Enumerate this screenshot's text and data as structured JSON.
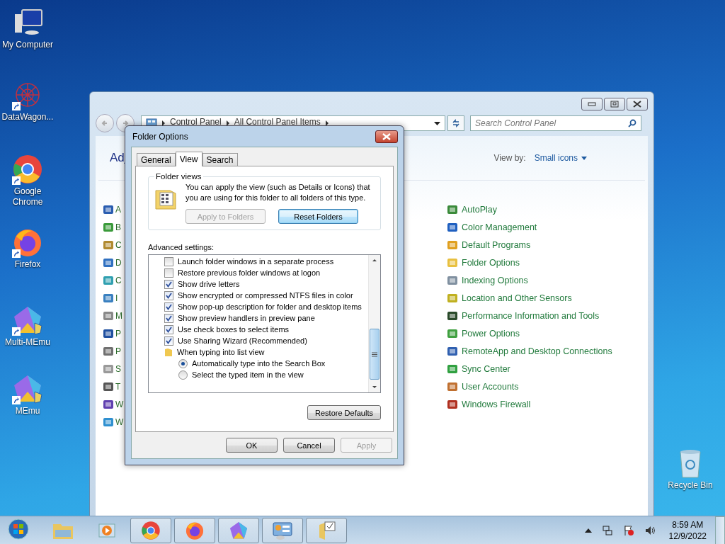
{
  "desktop_icons": [
    {
      "label": "My Computer",
      "kind": "computer",
      "shortcut": false
    },
    {
      "label": "DataWagon...",
      "kind": "network",
      "shortcut": true
    },
    {
      "label": "Google Chrome",
      "kind": "chrome",
      "shortcut": true
    },
    {
      "label": "Firefox",
      "kind": "firefox",
      "shortcut": true
    },
    {
      "label": "Multi-MEmu",
      "kind": "memu",
      "shortcut": true
    },
    {
      "label": "MEmu",
      "kind": "memu",
      "shortcut": true
    }
  ],
  "recycle_bin": {
    "label": "Recycle Bin"
  },
  "control_panel": {
    "breadcrumb": [
      "Control Panel",
      "All Control Panel Items"
    ],
    "search_placeholder": "Search Control Panel",
    "heading": "Adj",
    "view_by_label": "View by:",
    "view_by_value": "Small icons",
    "left_items": [
      "A",
      "B",
      "C",
      "D",
      "C",
      "I",
      "M",
      "P",
      "P",
      "S",
      "T",
      "W",
      "W"
    ],
    "right_items": [
      "AutoPlay",
      "Color Management",
      "Default Programs",
      "Folder Options",
      "Indexing Options",
      "Location and Other Sensors",
      "Performance Information and Tools",
      "Power Options",
      "RemoteApp and Desktop Connections",
      "Sync Center",
      "User Accounts",
      "Windows Firewall"
    ]
  },
  "dialog": {
    "title": "Folder Options",
    "tabs": [
      {
        "label": "General",
        "selected": false
      },
      {
        "label": "View",
        "selected": true
      },
      {
        "label": "Search",
        "selected": false
      }
    ],
    "folder_views": {
      "legend": "Folder views",
      "text": "You can apply the view (such as Details or Icons) that you are using for this folder to all folders of this type.",
      "buttons": [
        {
          "label": "Apply to Folders",
          "disabled": true,
          "focused": false
        },
        {
          "label": "Reset Folders",
          "disabled": false,
          "focused": true
        }
      ]
    },
    "advanced_label": "Advanced settings:",
    "settings": [
      {
        "kind": "checkbox",
        "label": "Launch folder windows in a separate process",
        "checked": false
      },
      {
        "kind": "checkbox",
        "label": "Restore previous folder windows at logon",
        "checked": false
      },
      {
        "kind": "checkbox",
        "label": "Show drive letters",
        "checked": true
      },
      {
        "kind": "checkbox",
        "label": "Show encrypted or compressed NTFS files in color",
        "checked": true
      },
      {
        "kind": "checkbox",
        "label": "Show pop-up description for folder and desktop items",
        "checked": true
      },
      {
        "kind": "checkbox",
        "label": "Show preview handlers in preview pane",
        "checked": true
      },
      {
        "kind": "checkbox",
        "label": "Use check boxes to select items",
        "checked": true
      },
      {
        "kind": "checkbox",
        "label": "Use Sharing Wizard (Recommended)",
        "checked": true
      },
      {
        "kind": "folder",
        "label": "When typing into list view",
        "children": [
          {
            "kind": "radio",
            "label": "Automatically type into the Search Box",
            "selected": true
          },
          {
            "kind": "radio",
            "label": "Select the typed item in the view",
            "selected": false
          }
        ]
      }
    ],
    "restore_defaults": "Restore Defaults",
    "buttons": [
      {
        "label": "OK",
        "disabled": false
      },
      {
        "label": "Cancel",
        "disabled": false
      },
      {
        "label": "Apply",
        "disabled": true
      }
    ]
  },
  "taskbar": {
    "apps": [
      {
        "kind": "explorer",
        "open": false
      },
      {
        "kind": "media",
        "open": false
      },
      {
        "kind": "chrome",
        "open": true
      },
      {
        "kind": "firefox",
        "open": true
      },
      {
        "kind": "memu",
        "open": true
      },
      {
        "kind": "control",
        "open": true
      },
      {
        "kind": "folderopts",
        "open": true
      }
    ],
    "time": "8:59 AM",
    "date": "12/9/2022"
  }
}
